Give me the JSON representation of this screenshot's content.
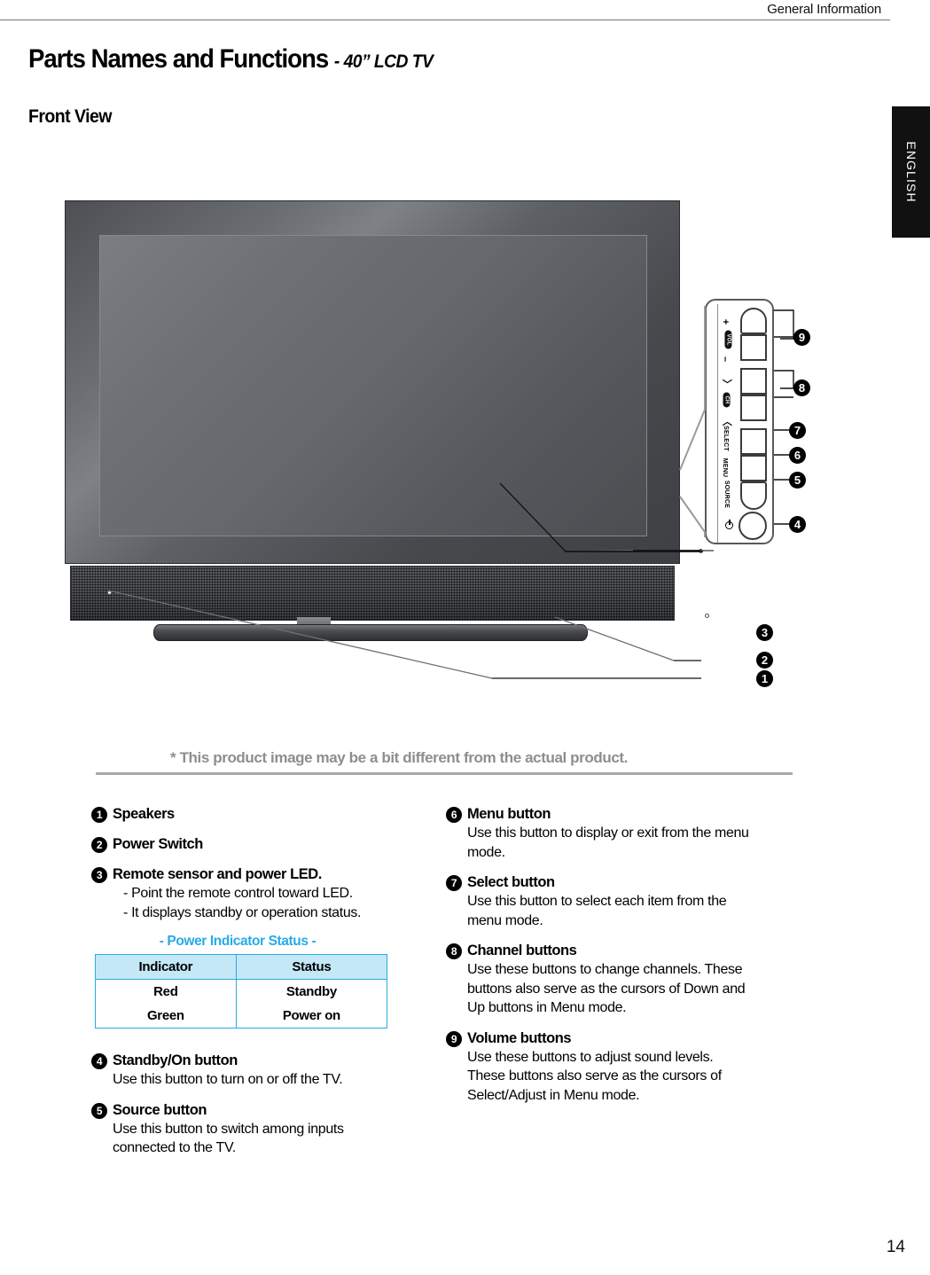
{
  "header": {
    "section_label": "General Information"
  },
  "titles": {
    "main": "Parts Names and Functions",
    "main_sub": "- 40” LCD TV",
    "section": "Front View"
  },
  "language_tab": {
    "label": "ENGLISH"
  },
  "figure": {
    "caption": "* This product image may be a bit different from the actual product.",
    "control_panel": {
      "vol_plus": "+",
      "vol_label": "VOL",
      "vol_minus": "–",
      "ch_up": "〉",
      "ch_label": "CH",
      "ch_down": "〈",
      "select_label": "SELECT",
      "menu_label": "MENU",
      "source_label": "SOURCE",
      "power_icon": "power-icon"
    },
    "callouts": [
      "1",
      "2",
      "3",
      "4",
      "5",
      "6",
      "7",
      "8",
      "9"
    ]
  },
  "left_column": {
    "items": [
      {
        "num": "1",
        "title": "Speakers",
        "lines": []
      },
      {
        "num": "2",
        "title": "Power Switch",
        "lines": []
      },
      {
        "num": "3",
        "title": "Remote sensor and power LED.",
        "lines": [
          "- Point the remote control toward LED.",
          "- It displays standby or operation status."
        ]
      },
      {
        "num": "4",
        "title": "Standby/On button",
        "lines": [
          "Use this button to turn on or off the TV."
        ]
      },
      {
        "num": "5",
        "title": "Source button",
        "lines": [
          "Use this button to switch among inputs",
          "connected to the TV."
        ]
      }
    ]
  },
  "right_column": {
    "items": [
      {
        "num": "6",
        "title": "Menu button",
        "lines": [
          "Use this button to display or exit from the menu",
          "mode."
        ]
      },
      {
        "num": "7",
        "title": "Select button",
        "lines": [
          "Use this button to select each item from the",
          "menu mode."
        ]
      },
      {
        "num": "8",
        "title": "Channel buttons",
        "lines": [
          "Use these buttons to change channels. These",
          "buttons also serve as the cursors of Down and",
          "Up buttons in Menu mode."
        ]
      },
      {
        "num": "9",
        "title": "Volume buttons",
        "lines": [
          "Use these buttons to adjust sound levels.",
          "These buttons also serve as the cursors of",
          "Select/Adjust in Menu mode."
        ]
      }
    ]
  },
  "status_table": {
    "title": "- Power Indicator Status -",
    "headers": [
      "Indicator",
      "Status"
    ],
    "rows": [
      [
        "Red",
        "Standby"
      ],
      [
        "Green",
        "Power on"
      ]
    ],
    "accent_color": "#29abe2",
    "header_bg": "#c5e8f7"
  },
  "footer": {
    "page_number": "14"
  }
}
